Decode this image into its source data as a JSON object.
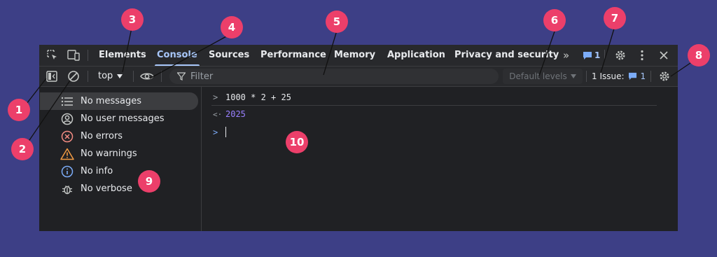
{
  "tabs": [
    "Elements",
    "Console",
    "Sources",
    "Performance",
    "Memory",
    "Application",
    "Privacy and security"
  ],
  "active_tab": "Console",
  "more_tabs_label": "»",
  "tab_bar_badge_count": "1",
  "toolbar": {
    "context_label": "top",
    "filter_placeholder": "Filter",
    "levels_label": "Default levels",
    "issues_label": "1 Issue:",
    "issues_count": "1"
  },
  "sidebar": {
    "items": [
      {
        "label": "No messages",
        "icon": "list-icon"
      },
      {
        "label": "No user messages",
        "icon": "user-icon"
      },
      {
        "label": "No errors",
        "icon": "error-icon"
      },
      {
        "label": "No warnings",
        "icon": "warning-icon"
      },
      {
        "label": "No info",
        "icon": "info-icon"
      },
      {
        "label": "No verbose",
        "icon": "bug-icon"
      }
    ]
  },
  "console": {
    "input_expression": "1000 * 2 + 25",
    "result_value": "2025",
    "prompt_symbol": ">",
    "result_symbol": "<·"
  },
  "callouts": [
    "1",
    "2",
    "3",
    "4",
    "5",
    "6",
    "7",
    "8",
    "9",
    "10"
  ],
  "colors": {
    "page_background": "#3d3f86",
    "callout": "#ec3f6a",
    "accent": "#a8c7fa",
    "result_number": "#9980ff"
  }
}
